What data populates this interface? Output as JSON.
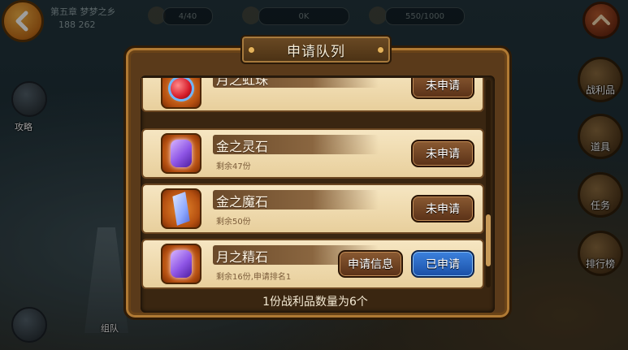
{
  "hud": {
    "stage_name": "第五章 梦梦之乡",
    "stage_sub": "188 262",
    "stat1": "4/40",
    "stat2": "0K",
    "stat3": "550/1000"
  },
  "left_buttons": {
    "strategy": "攻略",
    "bottom": "组队"
  },
  "side_menu": [
    {
      "label": "战利品"
    },
    {
      "label": "道具"
    },
    {
      "label": "任务"
    },
    {
      "label": "排行榜"
    }
  ],
  "panel": {
    "title": "申请队列",
    "footer": "1份战利品数量为6个"
  },
  "items": [
    {
      "name": "月之虹珠",
      "remain": "",
      "icon": "orb-icon",
      "buttons": [
        {
          "label": "未申请",
          "style": "brown"
        }
      ]
    },
    {
      "name": "金之灵石",
      "remain": "剩余47份",
      "icon": "purple-gem-icon",
      "buttons": [
        {
          "label": "未申请",
          "style": "brown"
        }
      ]
    },
    {
      "name": "金之魔石",
      "remain": "剩余50份",
      "icon": "blue-rune-icon",
      "buttons": [
        {
          "label": "未申请",
          "style": "brown"
        }
      ]
    },
    {
      "name": "月之精石",
      "remain": "剩余16份,申请排名1",
      "icon": "purple-gem-icon",
      "buttons": [
        {
          "label": "申请信息",
          "style": "brown"
        },
        {
          "label": "已申请",
          "style": "blue"
        }
      ]
    }
  ],
  "colors": {
    "panel_wood": "#5a3a1a",
    "row_bg": "#f0dbb0",
    "applied_blue": "#2a66c2"
  }
}
